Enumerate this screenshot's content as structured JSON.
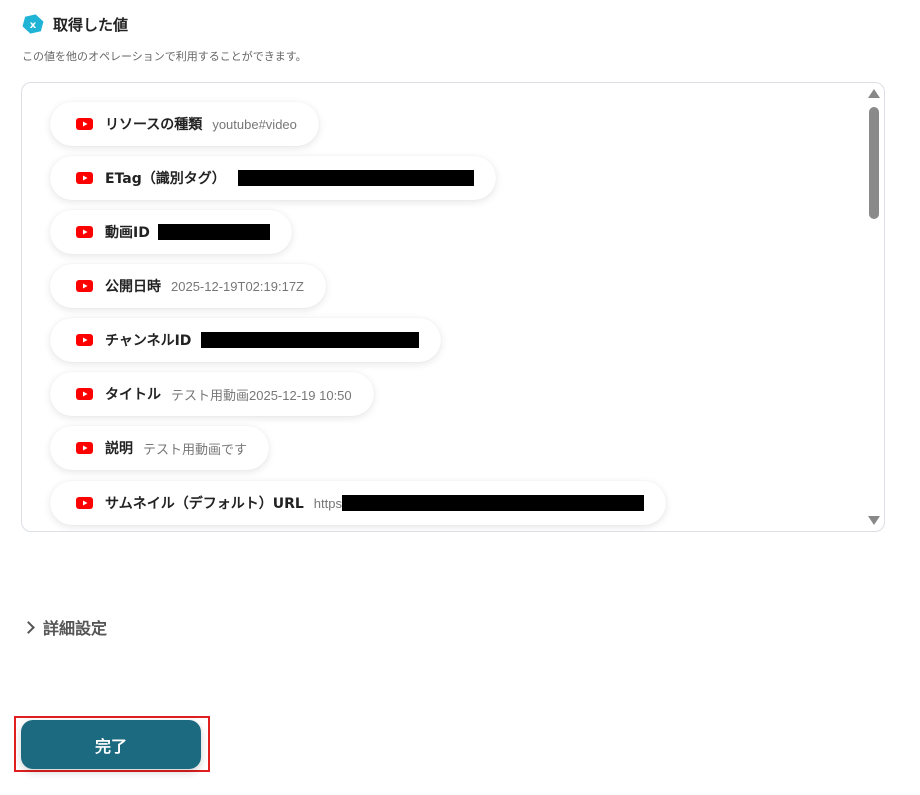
{
  "header": {
    "title": "取得した値",
    "icon": "x-hex-icon",
    "icon_color": "#1fb3d6"
  },
  "description": "この値を他のオペレーションで利用することができます。",
  "items": [
    {
      "label": "リソースの種類",
      "value": "youtube#video",
      "redacted": false
    },
    {
      "label": "ETag（識別タグ）",
      "value": "",
      "redacted": true
    },
    {
      "label": "動画ID",
      "value": "",
      "redacted": true
    },
    {
      "label": "公開日時",
      "value": "2025-12-19T02:19:17Z",
      "redacted": false
    },
    {
      "label": "チャンネルID",
      "value": "",
      "redacted": true
    },
    {
      "label": "タイトル",
      "value": "テスト用動画2025-12-19 10:50",
      "redacted": false
    },
    {
      "label": "説明",
      "value": "テスト用動画です",
      "redacted": false
    },
    {
      "label": "サムネイル（デフォルト）URL",
      "value": "https",
      "redacted": true
    }
  ],
  "item_icon": "youtube-icon",
  "item_icon_color": "#ff0000",
  "details": {
    "label": "詳細設定"
  },
  "done": {
    "label": "完了",
    "color": "#1c6a80"
  }
}
